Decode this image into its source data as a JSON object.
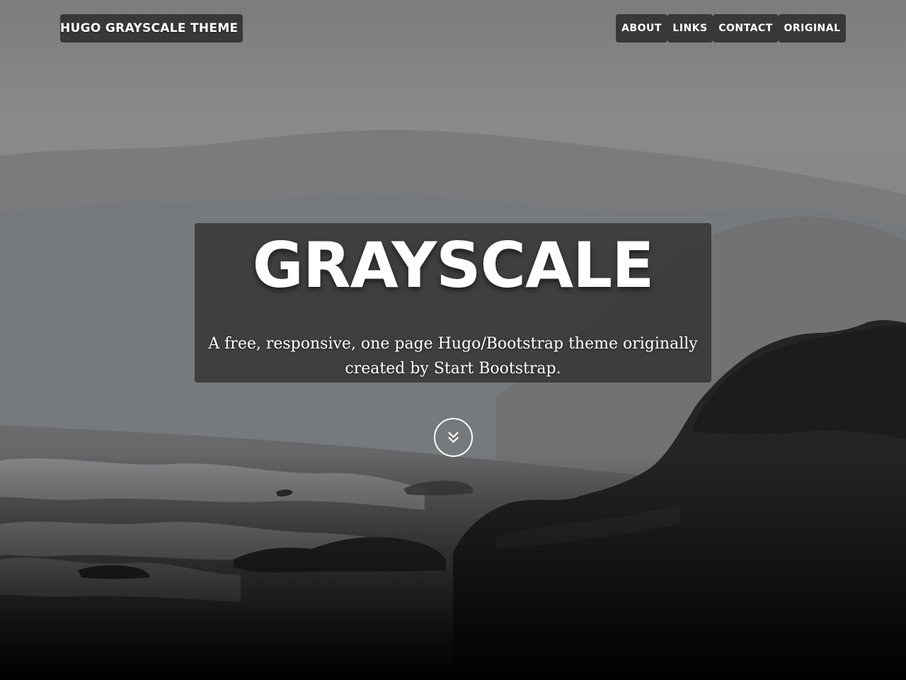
{
  "navbar": {
    "brand": "HUGO GRAYSCALE THEME",
    "items": [
      {
        "label": "ABOUT"
      },
      {
        "label": "LINKS"
      },
      {
        "label": "CONTACT"
      },
      {
        "label": "ORIGINAL"
      }
    ]
  },
  "hero": {
    "title": "GRAYSCALE",
    "subtitle": "A free, responsive, one page Hugo/Bootstrap theme originally created by Start Bootstrap.",
    "scroll_icon": "double-chevron-down-icon"
  },
  "colors": {
    "overlay": "#323232",
    "text": "#ffffff",
    "sky": "#8a8a8a",
    "dark_bottom": "#0a0a0a"
  }
}
